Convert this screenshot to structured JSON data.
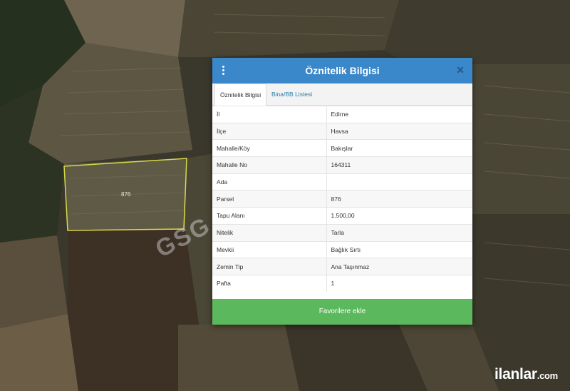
{
  "map": {
    "parcel_label": "876",
    "watermark": "GSG E",
    "brand_name": "ilanlar",
    "brand_tld": ".com"
  },
  "dialog": {
    "title": "Öznitelik Bilgisi",
    "menu_icon": "kebab-menu-icon",
    "close_icon": "close-icon",
    "tabs": [
      {
        "label": "Öznitelik Bilgisi",
        "active": true
      },
      {
        "label": "Bina/BB Listesi",
        "active": false
      }
    ],
    "rows": [
      {
        "key": "İl",
        "value": "Edirne"
      },
      {
        "key": "İlçe",
        "value": "Havsa"
      },
      {
        "key": "Mahalle/Köy",
        "value": "Bakışlar"
      },
      {
        "key": "Mahalle No",
        "value": "164311"
      },
      {
        "key": "Ada",
        "value": ""
      },
      {
        "key": "Parsel",
        "value": "876"
      },
      {
        "key": "Tapu Alanı",
        "value": "1.500,00"
      },
      {
        "key": "Nitelik",
        "value": "Tarla"
      },
      {
        "key": "Mevkii",
        "value": "Bağlık Sırtı"
      },
      {
        "key": "Zemin Tip",
        "value": "Ana Taşınmaz"
      },
      {
        "key": "Pafta",
        "value": "1"
      }
    ],
    "favorite_button": "Favorilere ekle",
    "colors": {
      "header": "#3a87c9",
      "favorite": "#5cb85c",
      "tab_link": "#2a7da6"
    }
  }
}
